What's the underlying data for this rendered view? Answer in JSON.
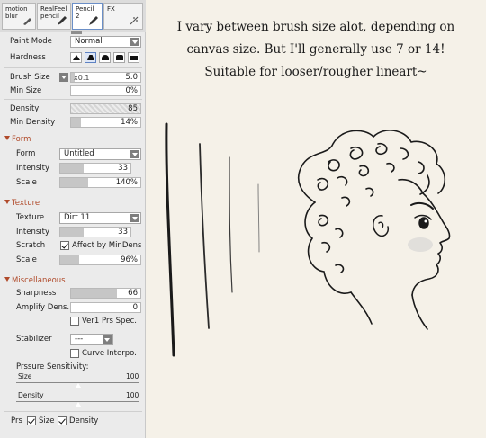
{
  "tool_tabs": [
    {
      "line1": "motion",
      "line2": "blur",
      "icon": "smudge-icon",
      "selected": false
    },
    {
      "line1": "RealFeel",
      "line2": "pencil",
      "icon": "pencil-icon",
      "selected": false
    },
    {
      "line1": "Pencil",
      "line2": "2",
      "icon": "pencil-icon",
      "selected": true
    },
    {
      "line1": "FX",
      "line2": "",
      "icon": "sparkle-icon",
      "selected": false
    }
  ],
  "paint_mode": {
    "label": "Paint Mode",
    "value": "Normal"
  },
  "hardness": {
    "label": "Hardness",
    "options": 5,
    "selected": 1
  },
  "brush_size": {
    "label": "Brush Size",
    "multiplier": "x0.1",
    "value": "5.0",
    "fraction": 0.05
  },
  "min_size": {
    "label": "Min Size",
    "value": "0%",
    "fraction": 0.0
  },
  "density": {
    "label": "Density",
    "value": "85",
    "fraction": 0.85
  },
  "min_density": {
    "label": "Min Density",
    "value": "14%",
    "fraction": 0.14
  },
  "form": {
    "header": "Form",
    "form_label": "Form",
    "form_value": "Untitled",
    "intensity_label": "Intensity",
    "intensity_value": "33",
    "intensity_fraction": 0.33,
    "scale_label": "Scale",
    "scale_value": "140%",
    "scale_fraction": 0.35
  },
  "texture": {
    "header": "Texture",
    "texture_label": "Texture",
    "texture_value": "Dirt 11",
    "intensity_label": "Intensity",
    "intensity_value": "33",
    "intensity_fraction": 0.33,
    "scratch_label": "Scratch",
    "scratch_check_label": "Affect by MinDens",
    "scratch_checked": true,
    "scale_label": "Scale",
    "scale_value": "96%",
    "scale_fraction": 0.24
  },
  "misc": {
    "header": "Miscellaneous",
    "sharpness_label": "Sharpness",
    "sharpness_value": "66",
    "sharpness_fraction": 0.66,
    "amplify_label": "Amplify Dens.",
    "amplify_value": "0",
    "amplify_fraction": 0.0,
    "ver1_label": "Ver1 Prs Spec.",
    "ver1_checked": false,
    "stabilizer_label": "Stabilizer",
    "stabilizer_value": "---",
    "curve_label": "Curve Interpo.",
    "curve_checked": false,
    "pressure_header": "Prssure Sensitivity:",
    "size_label": "Size",
    "size_value": "100",
    "density_label": "Density",
    "density_value": "100"
  },
  "prs": {
    "label": "Prs",
    "size_label": "Size",
    "size_checked": true,
    "density_label": "Density",
    "density_checked": true
  },
  "caption": [
    "I vary between brush size alot, depending on",
    "canvas size. But I'll generally use 7 or 14!",
    "Suitable for looser/rougher lineart~"
  ],
  "colors": {
    "panel_bg": "#ebebeb",
    "section_accent": "#b04a2a",
    "slider_fill": "#c6c6c6",
    "canvas_bg": "#f5f1e8",
    "ink": "#1a1a1a"
  }
}
